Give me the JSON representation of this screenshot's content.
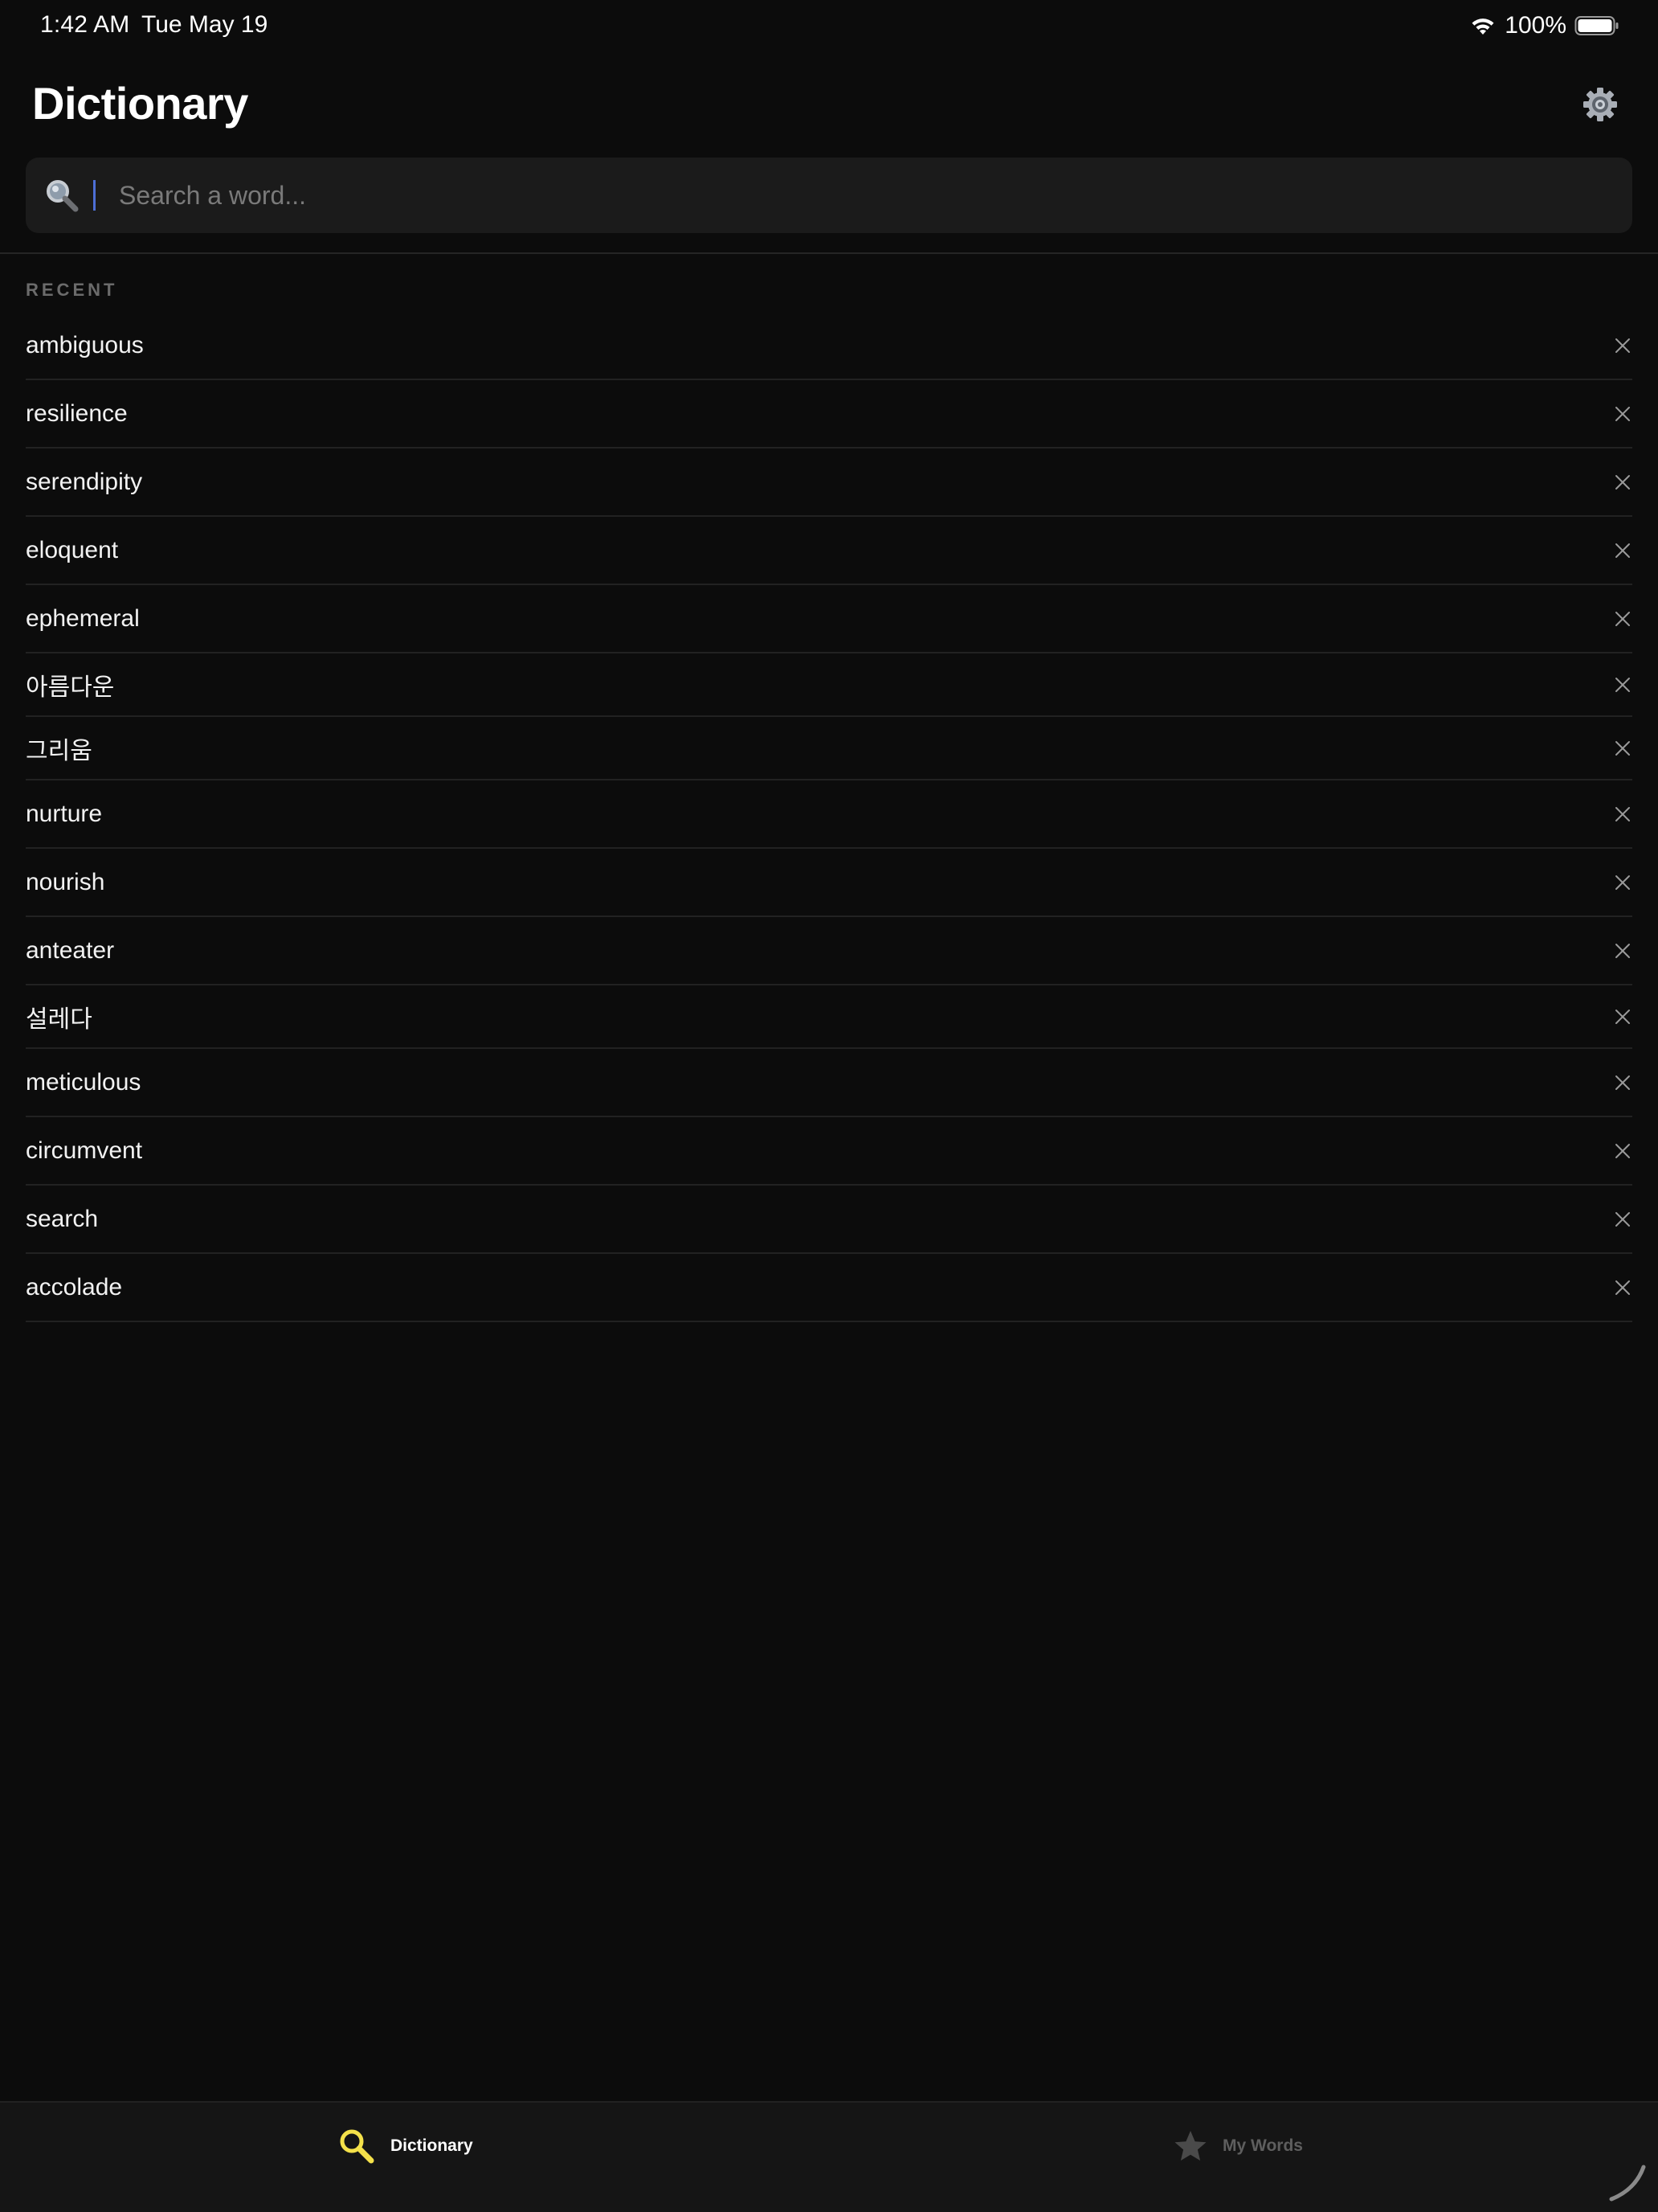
{
  "status_bar": {
    "time": "1:42 AM",
    "date": "Tue May 19",
    "battery_percent": "100%",
    "icons": [
      "wifi-icon",
      "battery-icon"
    ]
  },
  "header": {
    "title": "Dictionary",
    "settings_icon": "gear-icon"
  },
  "search": {
    "placeholder": "Search a word...",
    "value": "",
    "icon": "search-icon"
  },
  "recent": {
    "label": "RECENT",
    "items": [
      {
        "word": "ambiguous"
      },
      {
        "word": "resilience"
      },
      {
        "word": "serendipity"
      },
      {
        "word": "eloquent"
      },
      {
        "word": "ephemeral"
      },
      {
        "word": "아름다운"
      },
      {
        "word": "그리움"
      },
      {
        "word": "nurture"
      },
      {
        "word": "nourish"
      },
      {
        "word": "anteater"
      },
      {
        "word": "설레다"
      },
      {
        "word": "meticulous"
      },
      {
        "word": "circumvent"
      },
      {
        "word": "search"
      },
      {
        "word": "accolade"
      }
    ],
    "remove_icon": "close-icon"
  },
  "tab_bar": {
    "tabs": [
      {
        "label": "Dictionary",
        "icon": "magnifier-icon",
        "active": true
      },
      {
        "label": "My Words",
        "icon": "star-icon",
        "active": false
      }
    ]
  },
  "colors": {
    "background": "#0c0c0c",
    "accent": "#f4e14a",
    "inactive": "#5e5e5e"
  }
}
